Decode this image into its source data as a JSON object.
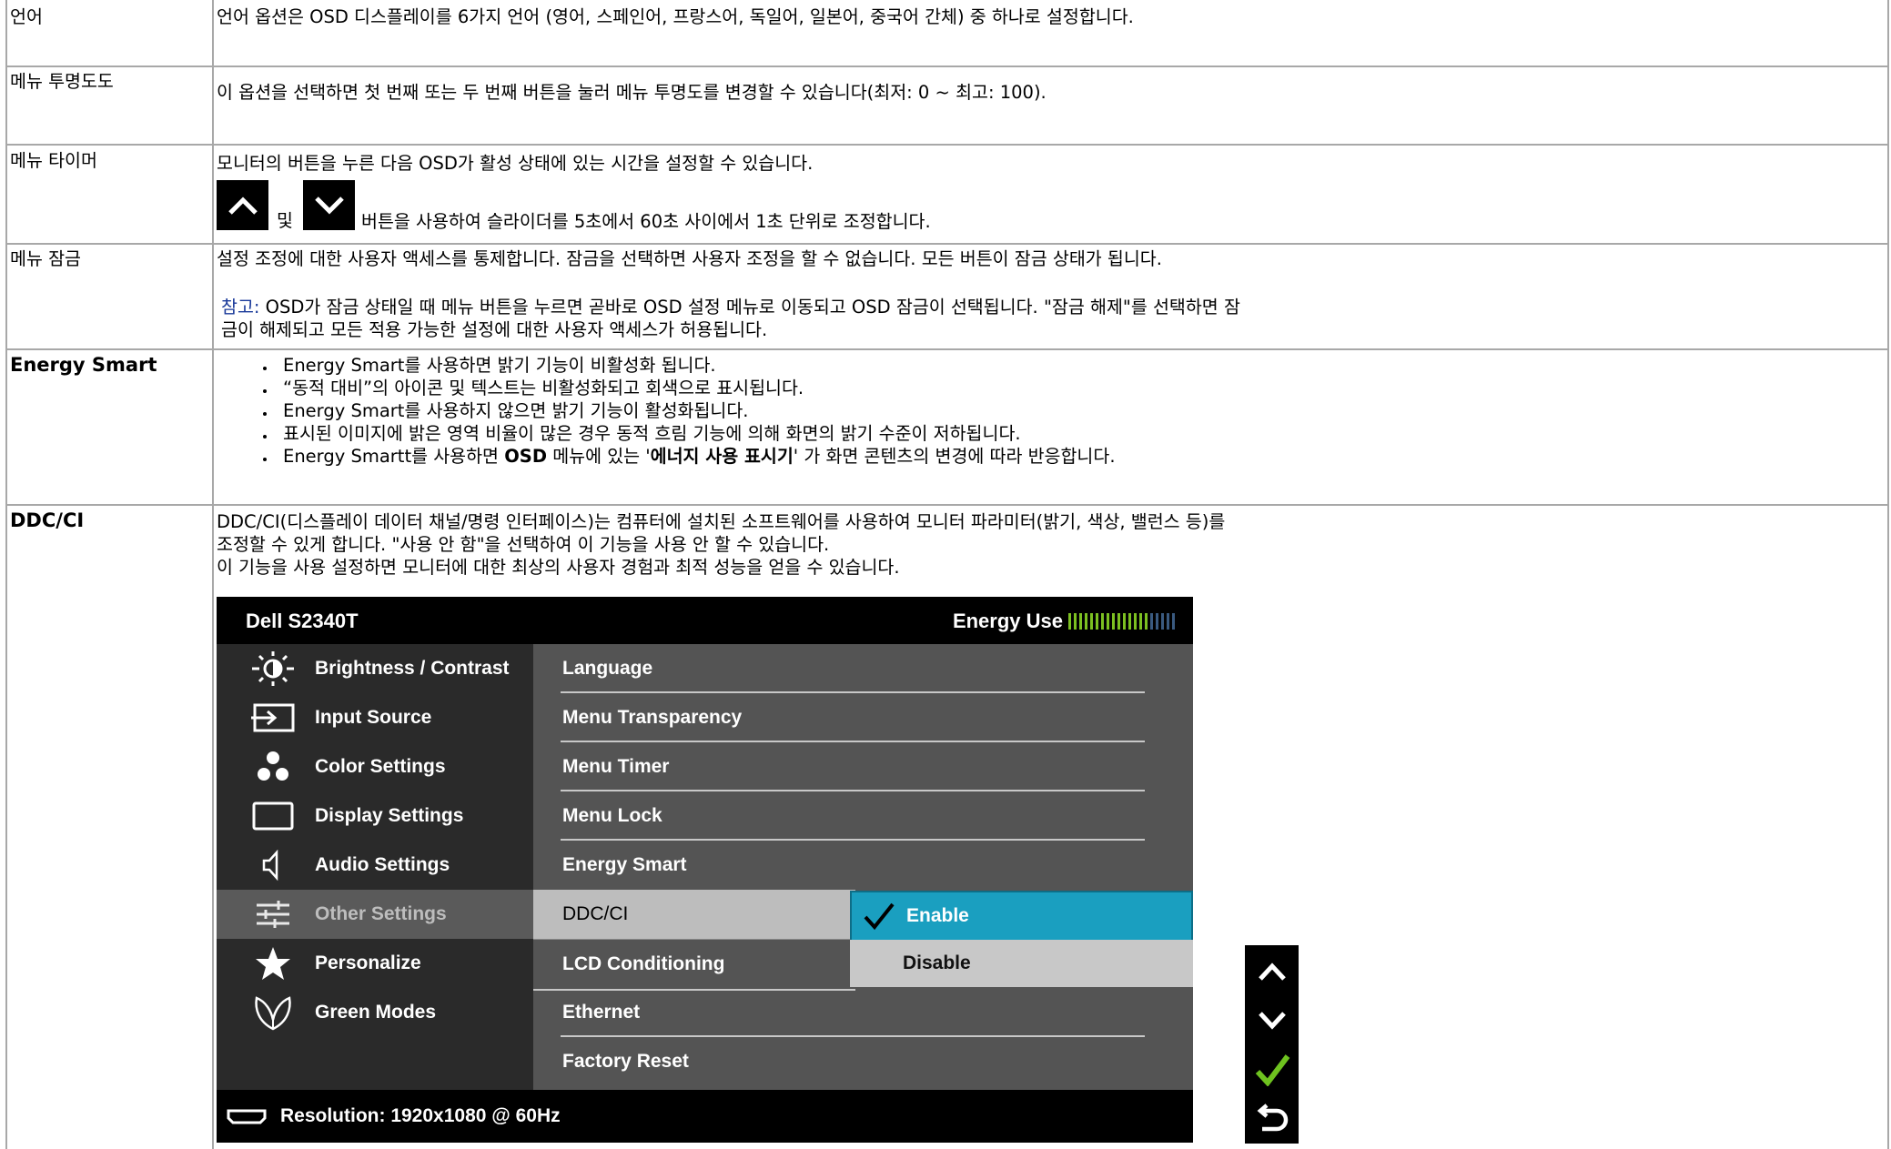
{
  "rows": [
    {
      "label": "언어",
      "desc": [
        "언어 옵션은 OSD 디스플레이를 6가지 언어 (영어, 스페인어, 프랑스어, 독일어, 일본어, 중국어 간체) 중 하나로 설정합니다."
      ]
    },
    {
      "label": "메뉴 투명도도",
      "desc": [
        "이 옵션을 선택하면 첫 번째 또는 두 번째 버튼을 눌러 메뉴 투명도를 변경할 수 있습니다(최저: 0 ~ 최고: 100)."
      ]
    },
    {
      "label": "메뉴 타이머",
      "desc": [
        "모니터의 버튼을 누른 다음 OSD가 활성 상태에 있는 시간을 설정할 수 있습니다."
      ],
      "and_text": "및",
      "after_text": "버튼을 사용하여 슬라이더를 5초에서 60초 사이에서 1초 단위로 조정합니다."
    },
    {
      "label": "메뉴 잠금",
      "desc": [
        "설정 조정에 대한 사용자 액세스를 통제합니다. 잠금을 선택하면 사용자 조정을 할 수 없습니다. 모든 버튼이 잠금 상태가 됩니다."
      ],
      "note_label": "참고:",
      "note_line1": " OSD가 잠금 상태일 때 메뉴 버튼을 누르면 곧바로 OSD 설정 메뉴로 이동되고 OSD 잠금이 선택됩니다. \"잠금 해제\"를 선택하면 잠",
      "note_line2": "금이 해제되고 모든 적용 가능한 설정에 대한 사용자 액세스가 허용됩니다."
    },
    {
      "label": "Energy Smart",
      "bullets": [
        "Energy Smart를 사용하면 밝기 기능이 비활성화 됩니다.",
        "“동적 대비”의 아이콘 및 텍스트는 비활성화되고 회색으로 표시됩니다.",
        "Energy Smart를 사용하지 않으면 밝기 기능이 활성화됩니다.",
        "표시된 이미지에 밝은 영역 비율이 많은 경우 동적 흐림 기능에 의해 화면의 밝기 수준이 저하됩니다."
      ],
      "bullet5_a": "Energy Smartt를 사용하면 ",
      "bullet5_b": "OSD",
      "bullet5_c": " 메뉴에 있는 '",
      "bullet5_d": "에너지 사용 표시기",
      "bullet5_e": "' 가 화면 콘텐츠의 변경에 따라 반응합니다."
    },
    {
      "label": "DDC/CI",
      "desc": [
        "DDC/CI(디스플레이 데이터 채널/명령 인터페이스)는 컴퓨터에 설치된 소프트웨어를 사용하여 모니터 파라미터(밝기, 색상, 밸런스 등)를",
        "조정할 수 있게 합니다. \"사용 안 함\"을 선택하여 이 기능을 사용 안 할 수 있습니다.",
        "이 기능을 사용 설정하면 모니터에 대한 최상의 사용자 경험과 최적 성능을 얻을 수 있습니다."
      ]
    }
  ],
  "osd": {
    "title": "Dell S2340T",
    "energy_label": "Energy Use",
    "energy_level": 0.75,
    "menu": [
      {
        "label": "Brightness / Contrast",
        "icon": "brightness-icon"
      },
      {
        "label": "Input Source",
        "icon": "input-source-icon"
      },
      {
        "label": "Color Settings",
        "icon": "color-settings-icon"
      },
      {
        "label": "Display Settings",
        "icon": "display-settings-icon"
      },
      {
        "label": "Audio Settings",
        "icon": "audio-icon"
      },
      {
        "label": "Other Settings",
        "icon": "other-settings-icon"
      },
      {
        "label": "Personalize",
        "icon": "star-icon"
      },
      {
        "label": "Green Modes",
        "icon": "green-modes-icon"
      }
    ],
    "submenu": [
      "Language",
      "Menu Transparency",
      "Menu Timer",
      "Menu Lock",
      "Energy Smart",
      "DDC/CI",
      "LCD Conditioning",
      "Ethernet",
      "Factory Reset"
    ],
    "options": [
      "Enable",
      "Disable"
    ],
    "resolution": "Resolution: 1920x1080 @ 60Hz"
  }
}
